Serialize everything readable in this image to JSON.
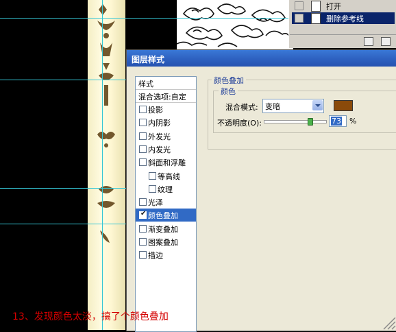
{
  "history": {
    "items": [
      {
        "label": "打开"
      },
      {
        "label": "删除参考线"
      }
    ]
  },
  "dialog": {
    "title": "图层样式",
    "list": {
      "header": "样式",
      "blend_options": "混合选项:自定",
      "items": [
        {
          "label": "投影",
          "checked": false
        },
        {
          "label": "内阴影",
          "checked": false
        },
        {
          "label": "外发光",
          "checked": false
        },
        {
          "label": "内发光",
          "checked": false
        },
        {
          "label": "斜面和浮雕",
          "checked": false
        },
        {
          "label": "等高线",
          "checked": false
        },
        {
          "label": "纹理",
          "checked": false
        },
        {
          "label": "光泽",
          "checked": false
        },
        {
          "label": "颜色叠加",
          "checked": true,
          "selected": true
        },
        {
          "label": "渐变叠加",
          "checked": false
        },
        {
          "label": "图案叠加",
          "checked": false
        },
        {
          "label": "描边",
          "checked": false
        }
      ]
    },
    "color_overlay": {
      "group_title": "颜色叠加",
      "subgroup_title": "颜色",
      "blend_mode_label": "混合模式:",
      "blend_mode_value": "变暗",
      "overlay_color": "#8a4a0a",
      "opacity_label": "不透明度(O):",
      "opacity_value": "73",
      "opacity_fraction": 0.73,
      "opacity_unit": "%"
    }
  },
  "caption": "13、发现颜色太淡，搞了个颜色叠加",
  "colors": {
    "guide": "#35c6d6",
    "title_bar": "#2c5fbe",
    "selection": "#316ac5",
    "caption": "#d40000"
  }
}
